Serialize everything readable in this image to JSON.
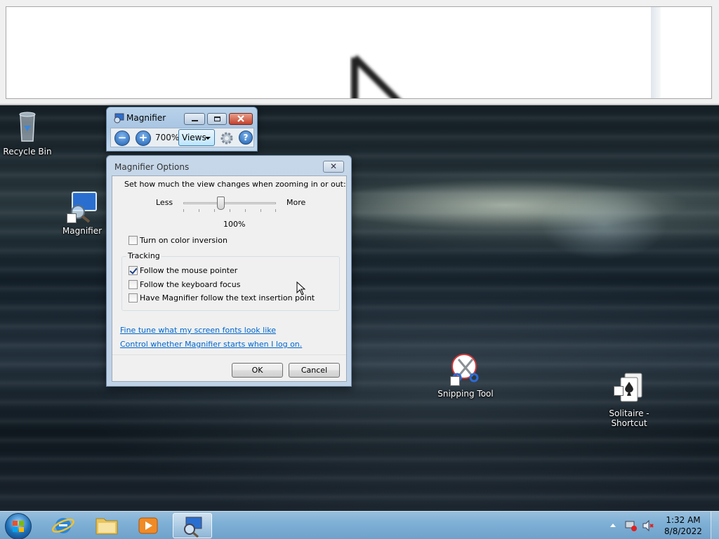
{
  "lens": {},
  "desktop": {
    "icons": [
      {
        "label": "Recycle Bin"
      },
      {
        "label": "Magnifier"
      },
      {
        "label": "Snipping Tool"
      },
      {
        "label": "Solitaire -\nShortcut"
      }
    ]
  },
  "magnifier": {
    "title": "Magnifier",
    "zoom_out_glyph": "−",
    "zoom_in_glyph": "+",
    "zoom_level": "700%",
    "views_label": "Views",
    "help_glyph": "?"
  },
  "options_dialog": {
    "title": "Magnifier Options",
    "close_glyph": "✕",
    "zoom_instructions": "Set how much the view changes when zooming in or out:",
    "slider": {
      "min_label": "Less",
      "max_label": "More",
      "value_label": "100%",
      "position": 0.42
    },
    "color_inversion": {
      "label": "Turn on color inversion",
      "checked": false
    },
    "tracking": {
      "legend": "Tracking",
      "options": [
        {
          "label": "Follow the mouse pointer",
          "checked": true
        },
        {
          "label": "Follow the keyboard focus",
          "checked": false
        },
        {
          "label": "Have Magnifier follow the text insertion point",
          "checked": false
        }
      ]
    },
    "links": [
      "Fine tune what my screen fonts look like",
      "Control whether Magnifier starts when I log on."
    ],
    "ok_label": "OK",
    "cancel_label": "Cancel"
  },
  "taskbar": {
    "items": [
      "start-orb",
      "internet-explorer",
      "windows-explorer",
      "windows-media-player",
      "magnifier"
    ],
    "clock": {
      "time": "1:32 AM",
      "date": "8/8/2022"
    }
  },
  "colors": {
    "link": "#0066cc",
    "checkmark": "#1b3f8a",
    "close_button": "#c2422c"
  }
}
